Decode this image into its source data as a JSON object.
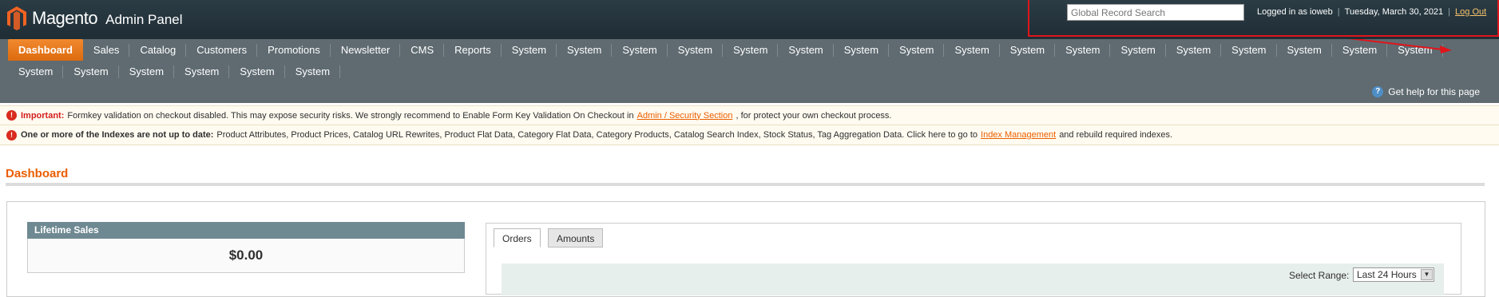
{
  "header": {
    "logo_text": "Magento",
    "logo_sub": "Admin Panel",
    "search_placeholder": "Global Record Search",
    "logged_in": "Logged in as ioweb",
    "date": "Tuesday, March 30, 2021",
    "logout": "Log Out"
  },
  "nav": {
    "row1": [
      "Dashboard",
      "Sales",
      "Catalog",
      "Customers",
      "Promotions",
      "Newsletter",
      "CMS",
      "Reports",
      "System",
      "System",
      "System",
      "System",
      "System",
      "System",
      "System",
      "System",
      "System",
      "System",
      "System",
      "System",
      "System",
      "System",
      "System",
      "System",
      "System"
    ],
    "row2": [
      "System",
      "System",
      "System",
      "System",
      "System",
      "System"
    ],
    "help": "Get help for this page"
  },
  "messages": {
    "m1": {
      "title": "Important:",
      "text1": "Formkey validation on checkout disabled. This may expose security risks. We strongly recommend to Enable Form Key Validation On Checkout in",
      "link": "Admin / Security Section",
      "text2": ", for protect your own checkout process."
    },
    "m2": {
      "title": "One or more of the Indexes are not up to date:",
      "text1": "Product Attributes, Product Prices, Catalog URL Rewrites, Product Flat Data, Category Flat Data, Category Products, Catalog Search Index, Stock Status, Tag Aggregation Data. Click here to go to",
      "link": "Index Management",
      "text2": "and rebuild required indexes."
    }
  },
  "page": {
    "title": "Dashboard"
  },
  "lifetime_sales": {
    "label": "Lifetime Sales",
    "value": "$0.00"
  },
  "tabs": {
    "orders": "Orders",
    "amounts": "Amounts"
  },
  "range": {
    "label": "Select Range:",
    "value": "Last 24 Hours"
  },
  "colors": {
    "accent": "#eb5e00",
    "nav_bg": "#5f6b71",
    "header_bg": "#2b3c45",
    "annotation": "#e0151b"
  }
}
